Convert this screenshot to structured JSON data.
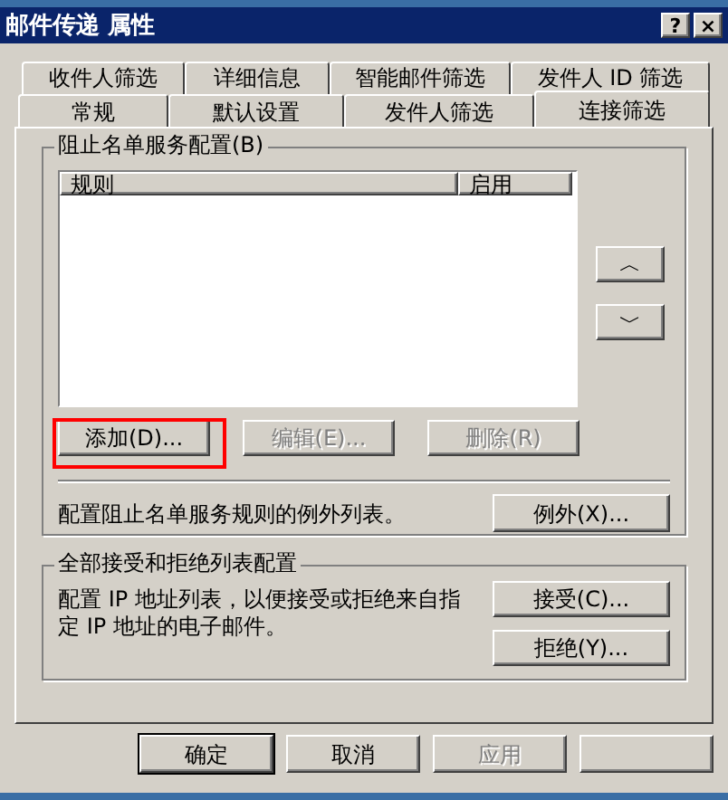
{
  "window": {
    "title": "邮件传递 属性",
    "buttons": [
      "?",
      "×"
    ]
  },
  "tab_rows": [
    [
      {
        "label": "收件人筛选",
        "selected": false
      },
      {
        "label": "详细信息",
        "selected": false
      },
      {
        "label": "智能邮件筛选",
        "selected": false
      },
      {
        "label": "发件人 ID 筛选",
        "selected": false
      }
    ],
    [
      {
        "label": "常规",
        "selected": false
      },
      {
        "label": "默认设置",
        "selected": false
      },
      {
        "label": "发件人筛选",
        "selected": false
      },
      {
        "label": "连接筛选",
        "selected": true
      }
    ]
  ],
  "blocklist_group": {
    "title": "阻止名单服务配置(B)",
    "columns": [
      "规则",
      "启用"
    ],
    "move_buttons": [
      {
        "label": "︿",
        "disabled": false
      },
      {
        "label": "﹀",
        "disabled": false
      }
    ],
    "buttons": [
      {
        "label": "添加(D)...",
        "disabled": false,
        "highlighted": true
      },
      {
        "label": "编辑(E)...",
        "disabled": true,
        "highlighted": false
      },
      {
        "label": "删除(R)",
        "disabled": true,
        "highlighted": false
      }
    ],
    "exception_text": "配置阻止名单服务规则的例外列表。",
    "exception_button": "例外(X)..."
  },
  "accept_reject_group": {
    "title": "全部接受和拒绝列表配置",
    "text": "配置 IP 地址列表，以便接受或拒绝来自指定 IP 地址的电子邮件。",
    "buttons": [
      "接受(C)...",
      "拒绝(Y)..."
    ]
  },
  "dialog_buttons": [
    {
      "label": "确定",
      "disabled": false,
      "default": true
    },
    {
      "label": "取消",
      "disabled": false,
      "default": false
    },
    {
      "label": "应用",
      "disabled": true,
      "default": false
    }
  ]
}
